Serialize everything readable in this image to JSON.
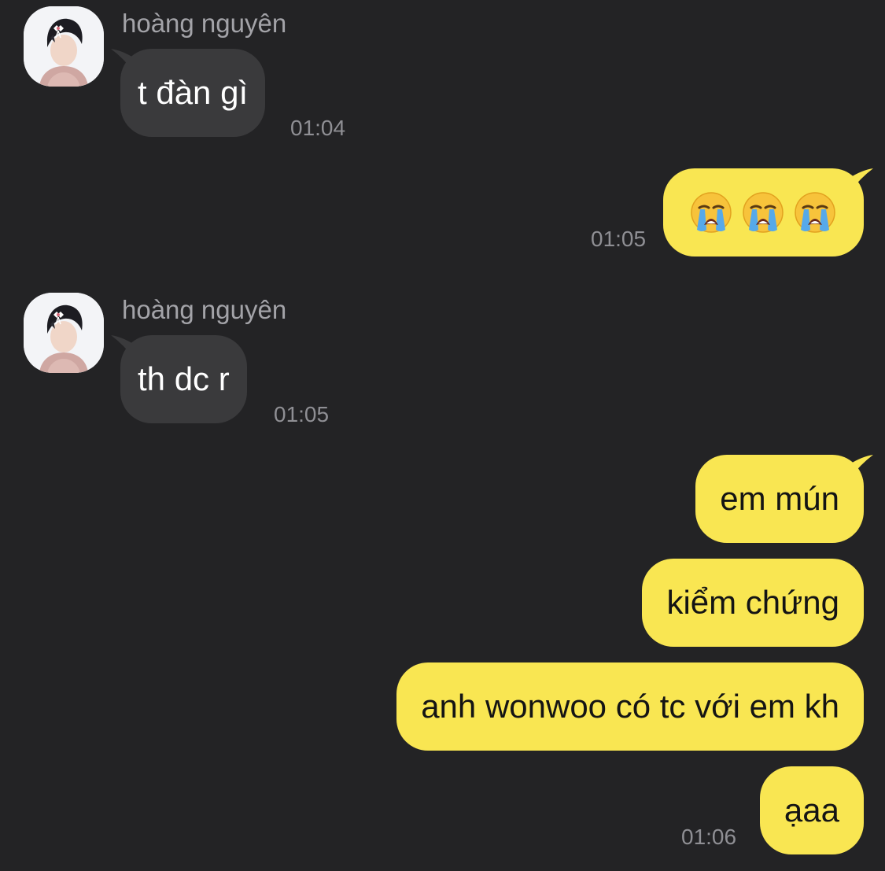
{
  "chat": {
    "messages": [
      {
        "sender": "hoàng nguyên",
        "text": "t đàn gì",
        "time": "01:04"
      },
      {
        "emoji": [
          "loudly-crying-face",
          "loudly-crying-face",
          "loudly-crying-face"
        ],
        "time": "01:05"
      },
      {
        "sender": "hoàng nguyên",
        "text": "th dc r",
        "time": "01:05"
      },
      {
        "text": "em mún"
      },
      {
        "text": "kiểm chứng"
      },
      {
        "text": "anh wonwoo có tc với em kh"
      },
      {
        "text": "ạaa",
        "time": "01:06"
      }
    ]
  },
  "colors": {
    "background": "#232325",
    "incoming_bubble": "#3a3a3c",
    "outgoing_bubble": "#f9e652",
    "timestamp": "#8f8f94",
    "sender_name": "#a3a3a8"
  }
}
